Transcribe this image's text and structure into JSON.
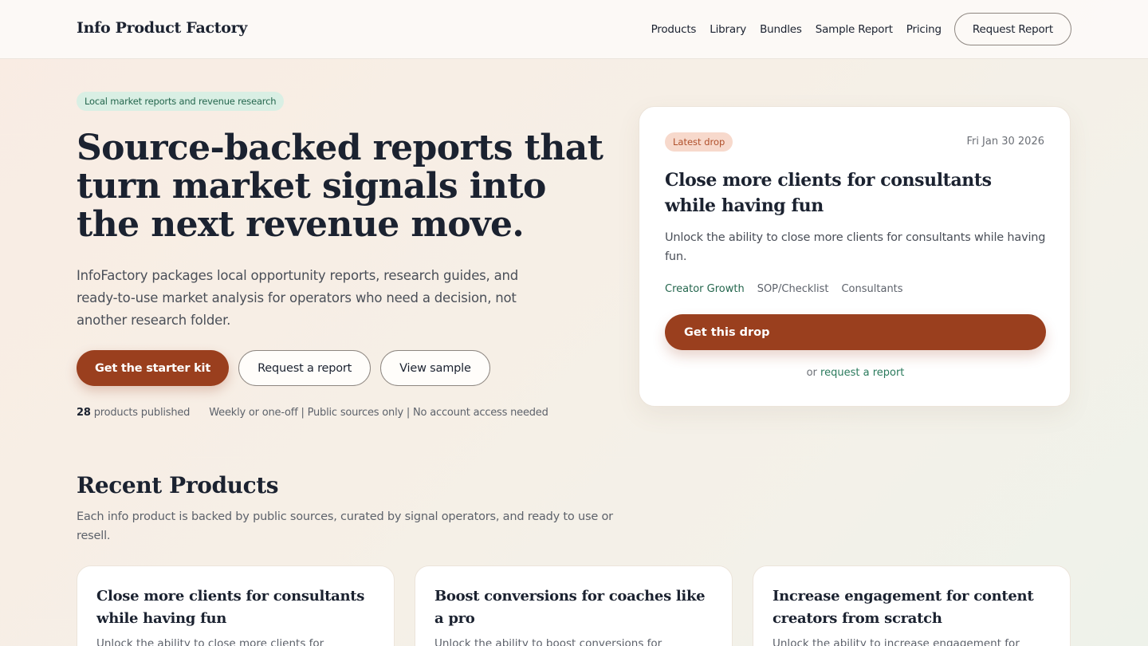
{
  "header": {
    "brand": "Info Product Factory",
    "nav": [
      "Products",
      "Library",
      "Bundles",
      "Sample Report",
      "Pricing"
    ],
    "request_button": "Request Report"
  },
  "hero": {
    "pill": "Local market reports and revenue research",
    "title": "Source-backed reports that turn market signals into the next revenue move.",
    "subtitle": "InfoFactory packages local opportunity reports, research guides, and ready-to-use market analysis for operators who need a decision, not another research folder.",
    "cta_primary": "Get the starter kit",
    "cta_request": "Request a report",
    "cta_sample": "View sample",
    "count": "28",
    "count_label": "products published",
    "meta": "Weekly or one-off | Public sources only | No account access needed"
  },
  "drop": {
    "badge": "Latest drop",
    "date": "Fri Jan 30 2026",
    "title": "Close more clients for consultants while having fun",
    "description": "Unlock the ability to close more clients for consultants while having fun.",
    "tags": [
      "Creator Growth",
      "SOP/Checklist",
      "Consultants"
    ],
    "button": "Get this drop",
    "alt_prefix": "or",
    "alt_link": "request a report"
  },
  "recent": {
    "title": "Recent Products",
    "subtitle": "Each info product is backed by public sources, curated by signal operators, and ready to use or resell.",
    "cards": [
      {
        "title": "Close more clients for consultants while having fun",
        "desc": "Unlock the ability to close more clients for"
      },
      {
        "title": "Boost conversions for coaches like a pro",
        "desc": "Unlock the ability to boost conversions for"
      },
      {
        "title": "Increase engagement for content creators from scratch",
        "desc": "Unlock the ability to increase engagement for"
      }
    ]
  },
  "colors": {
    "accent": "#9a3f1e",
    "green": "#24664d",
    "ink": "#1b2230"
  }
}
